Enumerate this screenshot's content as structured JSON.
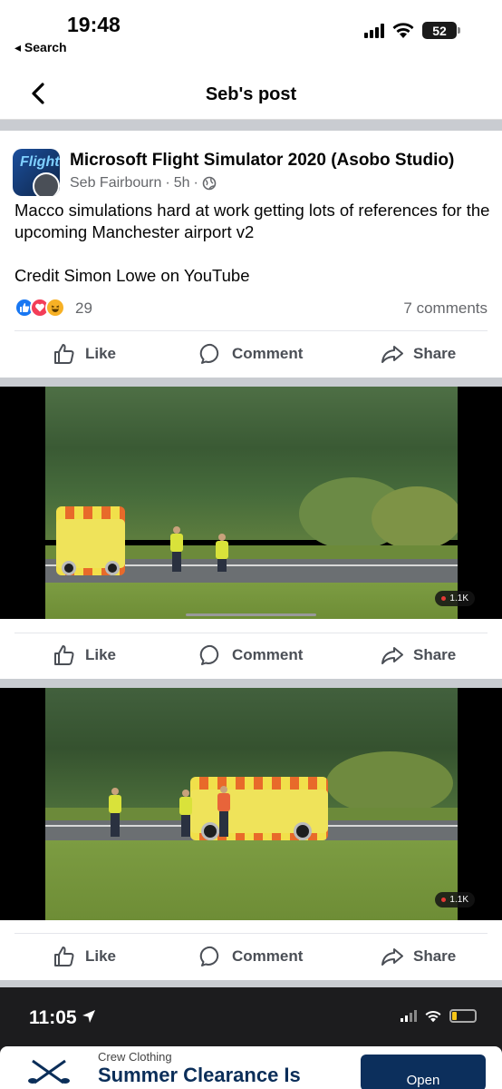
{
  "status_bar": {
    "time": "19:48",
    "back_app": "◂ Search",
    "battery": "52"
  },
  "nav": {
    "title": "Seb's post"
  },
  "post": {
    "group_name": "Microsoft Flight Simulator 2020 (Asobo Studio)",
    "author": "Seb Fairbourn",
    "time_ago": "5h",
    "separator": "·",
    "avatar_text": "Flight",
    "text_line1": "Macco simulations hard at work getting lots of references for the upcoming Manchester airport v2",
    "text_line2": "Credit Simon Lowe on YouTube",
    "reaction_count": "29",
    "comments_count": "7 comments"
  },
  "actions": {
    "like": "Like",
    "comment": "Comment",
    "share": "Share"
  },
  "videos": [
    {
      "viewers": "1.1K"
    },
    {
      "viewers": "1.1K"
    }
  ],
  "embedded_screenshot": {
    "time": "11:05",
    "ad_brand": "Crew Clothing",
    "ad_headline": "Summer Clearance Is",
    "ad_button": "Open"
  },
  "colors": {
    "like_blue": "#1877f2",
    "love_red": "#f33e58",
    "haha_yellow": "#f7b125",
    "ad_navy": "#0c2f5c"
  }
}
